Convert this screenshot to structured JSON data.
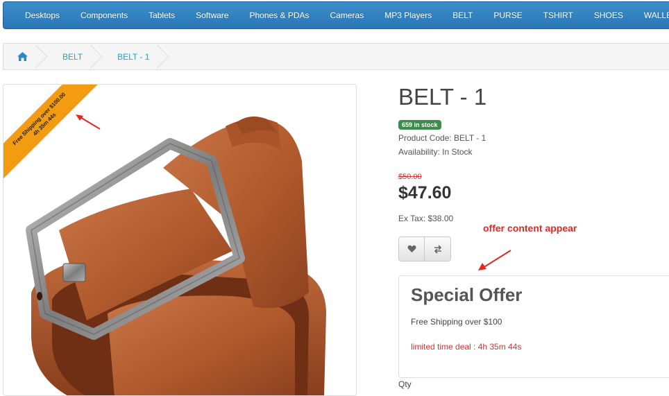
{
  "nav": {
    "items": [
      "Desktops",
      "Components",
      "Tablets",
      "Software",
      "Phones & PDAs",
      "Cameras",
      "MP3 Players",
      "BELT",
      "PURSE",
      "TSHIRT",
      "SHOES",
      "WALLET"
    ]
  },
  "breadcrumb": {
    "home_icon": "home-icon",
    "items": [
      "BELT",
      "BELT - 1"
    ]
  },
  "ribbon": {
    "line1": "Free Shipping over $100.00",
    "line2": "4h 35m 44s"
  },
  "product": {
    "title": "BELT - 1",
    "stock_badge": "659 in stock",
    "product_code": "Product Code: BELT - 1",
    "availability": "Availability: In Stock",
    "old_price": "$50.00",
    "price": "$47.60",
    "ex_tax": "Ex Tax: $38.00"
  },
  "annotation": {
    "note": "offer content appear",
    "color": "#e8251e"
  },
  "actions": {
    "wishlist_icon": "heart-icon",
    "compare_icon": "exchange-icon"
  },
  "offer": {
    "title": "Special Offer",
    "text": "Free Shipping over $100",
    "deal": "limited time deal : 4h 35m 44s"
  },
  "qty_label": "Qty",
  "colors": {
    "nav": "#2f80c0",
    "ribbon": "#f39c12",
    "badge": "#3a8d4b",
    "sale": "#d9322e"
  }
}
